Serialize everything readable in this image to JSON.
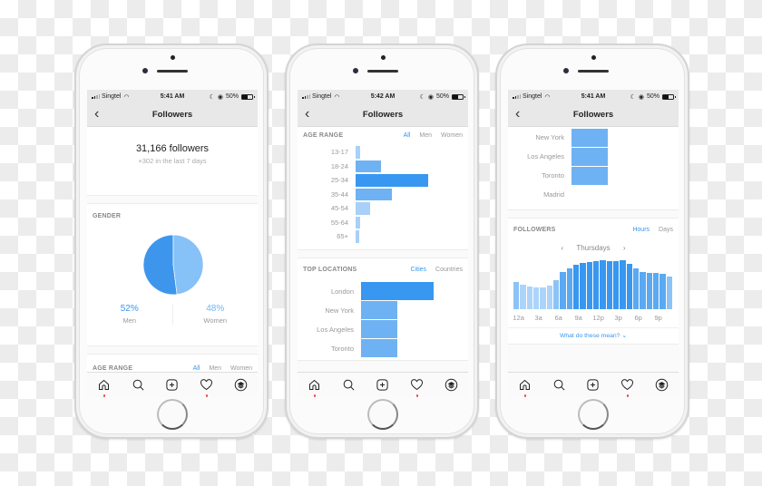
{
  "statusbar": {
    "carrier": "Singtel",
    "battery": "50%",
    "battery_level": 0.5,
    "times": [
      "5:41 AM",
      "5:42 AM",
      "5:41 AM"
    ]
  },
  "navbar": {
    "title": "Followers",
    "back_icon": "chevron-left-icon"
  },
  "overview": {
    "count": "31,166 followers",
    "delta": "+302 in the last 7 days"
  },
  "gender": {
    "label": "GENDER",
    "men_pct": "52%",
    "men_label": "Men",
    "women_pct": "48%",
    "women_label": "Women",
    "colors": {
      "men": "#3d96ec",
      "women": "#86c1f8"
    }
  },
  "age_range": {
    "label": "AGE RANGE",
    "filters": [
      "All",
      "Men",
      "Women"
    ],
    "active_filter": "All",
    "categories": [
      "13-17",
      "18-24",
      "25-34",
      "35-44",
      "45-54",
      "55-64",
      "65+"
    ],
    "values": [
      2,
      12,
      34,
      17,
      7,
      2,
      1.5
    ]
  },
  "top_locations": {
    "label": "TOP LOCATIONS",
    "filters": [
      "Cities",
      "Countries"
    ],
    "active_filter": "Cities",
    "cities": [
      "London",
      "New York",
      "Los Angeles",
      "Toronto",
      "Madrid"
    ],
    "values": [
      100,
      50,
      50,
      50,
      0
    ]
  },
  "followers_activity": {
    "label": "FOLLOWERS",
    "filters": [
      "Hours",
      "Days"
    ],
    "active_filter": "Hours",
    "day": "Thursdays",
    "prev_icon": "chevron-left-icon",
    "next_icon": "chevron-right-icon",
    "hour_ticks": [
      "12a",
      "3a",
      "6a",
      "9a",
      "12p",
      "3p",
      "6p",
      "9p"
    ],
    "hours": [
      0,
      1,
      2,
      3,
      4,
      5,
      6,
      7,
      8,
      9,
      10,
      11,
      12,
      13,
      14,
      15,
      16,
      17,
      18,
      19,
      20,
      21,
      22,
      23
    ],
    "values": [
      58,
      54,
      50,
      48,
      47,
      51,
      63,
      80,
      88,
      96,
      100,
      103,
      105,
      106,
      105,
      105,
      106,
      99,
      89,
      81,
      79,
      79,
      77,
      71
    ],
    "link": "What do these mean? ⌄"
  },
  "tabbar": {
    "items": [
      {
        "name": "home",
        "icon": "home-icon",
        "dot": true
      },
      {
        "name": "search",
        "icon": "search-icon",
        "dot": false
      },
      {
        "name": "new-post",
        "icon": "plus-square-icon",
        "dot": false
      },
      {
        "name": "activity",
        "icon": "heart-icon",
        "dot": true
      },
      {
        "name": "profile",
        "icon": "profile-stack-icon",
        "dot": false
      }
    ],
    "dot_color": "#ed4956"
  },
  "colors": {
    "accent": "#3897f0",
    "bar_dark": "#3897f0",
    "bar_mid": "#6fb2f3",
    "bar_light": "#a8d0f8"
  }
}
